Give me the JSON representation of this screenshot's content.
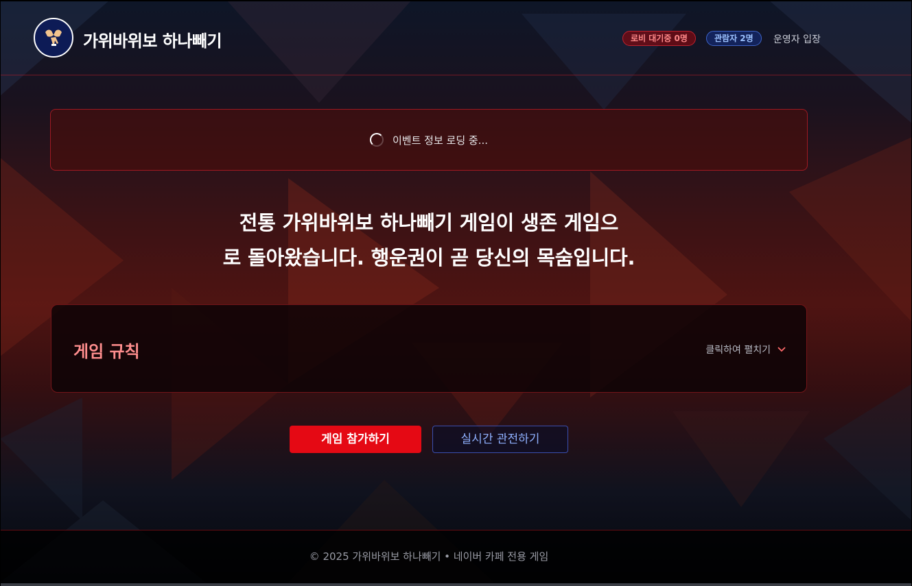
{
  "header": {
    "site_title": "가위바위보 하나빼기",
    "lobby_badge": "로비 대기중 0명",
    "spectator_badge": "관람자 2명",
    "admin_link": "운영자 입장"
  },
  "loading": {
    "text": "이벤트 정보 로딩 중..."
  },
  "hero": {
    "line1": "전통 가위바위보 하나빼기 게임이 생존 게임으",
    "line2": "로 돌아왔습니다. 행운권이 곧 당신의 목숨입니다."
  },
  "rules": {
    "title": "게임 규칙",
    "toggle_label": "클릭하여 펼치기"
  },
  "actions": {
    "join_label": "게임 참가하기",
    "watch_label": "실시간 관전하기"
  },
  "footer": {
    "text": "© 2025 가위바위보 하나빼기 • 네이버 카페 전용 게임"
  },
  "icons": {
    "logo": "hands-icon",
    "spinner": "loading-spinner-icon",
    "toggle": "chevron-down-icon"
  },
  "colors": {
    "accent_red": "#e50914",
    "rules_title": "#ff8e8e",
    "spectator_blue": "#9cc2ff"
  }
}
